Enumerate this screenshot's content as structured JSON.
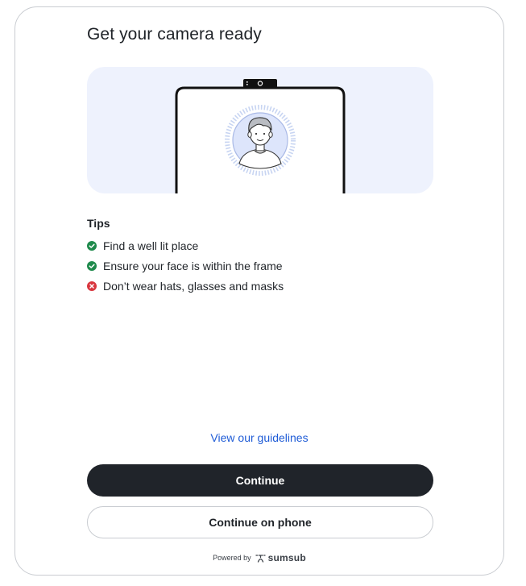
{
  "header": {
    "title": "Get your camera ready"
  },
  "illustration": {
    "icon": "camera-selfie-illustration"
  },
  "tips": {
    "heading": "Tips",
    "items": [
      {
        "label": "Find a well lit place",
        "status": "ok",
        "icon": "check-circle-icon",
        "color": "#1f8a4c"
      },
      {
        "label": "Ensure your face is within the frame",
        "status": "ok",
        "icon": "check-circle-icon",
        "color": "#1f8a4c"
      },
      {
        "label": "Don’t wear hats, glasses and masks",
        "status": "bad",
        "icon": "x-circle-icon",
        "color": "#d9363e"
      }
    ]
  },
  "links": {
    "guidelines": "View our guidelines"
  },
  "buttons": {
    "continue": "Continue",
    "continue_on_phone": "Continue on phone"
  },
  "footer": {
    "powered_by": "Powered by",
    "brand": "sumsub"
  },
  "colors": {
    "primary_button": "#20242a",
    "link": "#1e5bd6",
    "illustration_bg": "#eef2fd"
  }
}
